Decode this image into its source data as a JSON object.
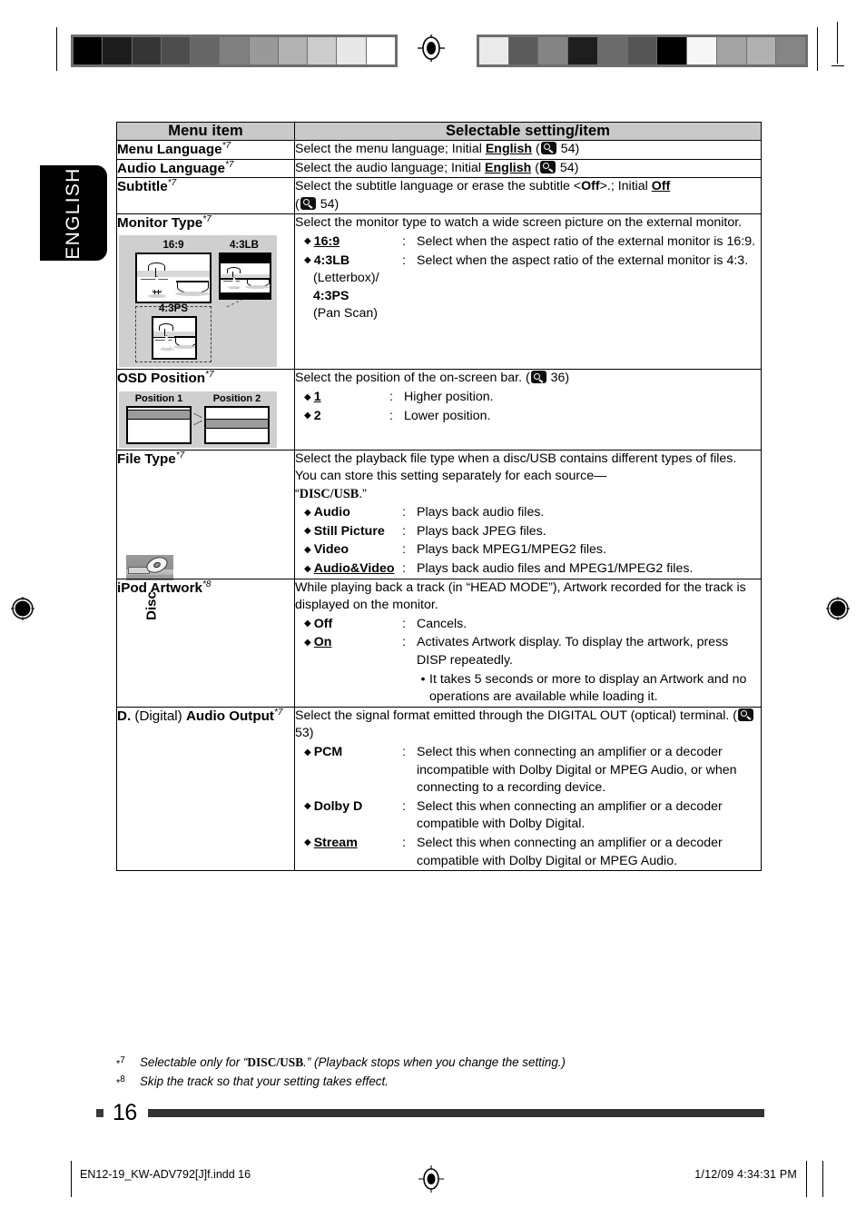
{
  "side_tab": {
    "label": "ENGLISH"
  },
  "source_marker": {
    "label": "Disc",
    "icon": "disc-icon"
  },
  "table": {
    "headers": {
      "menu_item": "Menu item",
      "selectable": "Selectable setting/item"
    },
    "rows": [
      {
        "id": "menu-language",
        "name": "Menu Language",
        "footnote": "*7",
        "description_prefix": "Select the menu language; Initial ",
        "initial_value": "English",
        "page_ref": "54"
      },
      {
        "id": "audio-language",
        "name": "Audio Language",
        "footnote": "*7",
        "description_prefix": "Select the audio language; Initial ",
        "initial_value": "English",
        "page_ref": "54"
      },
      {
        "id": "subtitle",
        "name": "Subtitle",
        "footnote": "*7",
        "description_prefix": "Select the subtitle language or erase the subtitle <",
        "inline_bold": "Off",
        "description_suffix": ">.; Initial ",
        "initial_value": "Off",
        "page_ref": "54"
      },
      {
        "id": "monitor-type",
        "name": "Monitor Type",
        "footnote": "*7",
        "description": "Select the monitor type to watch a wide screen picture on the external monitor.",
        "diagram": {
          "type": "monitor-type",
          "labels": [
            "16:9",
            "4:3LB",
            "4:3PS"
          ]
        },
        "options": [
          {
            "key": "16:9",
            "underline": true,
            "value": "Select when the aspect ratio of the external monitor is 16:9."
          },
          {
            "key": "4:3LB",
            "underline": false,
            "sub_key_lines": [
              "(Letterbox)/",
              "4:3PS",
              "(Pan Scan)"
            ],
            "value": "Select when the aspect ratio of the external monitor is 4:3."
          }
        ]
      },
      {
        "id": "osd-position",
        "name": "OSD Position",
        "footnote": "*7",
        "description_prefix": "Select the position of the on-screen bar. (",
        "page_ref": "36",
        "diagram": {
          "type": "osd-position",
          "labels": [
            "Position 1",
            "Position 2"
          ]
        },
        "options": [
          {
            "key": "1",
            "underline": true,
            "value": "Higher position."
          },
          {
            "key": "2",
            "underline": false,
            "value": "Lower position."
          }
        ]
      },
      {
        "id": "file-type",
        "name": "File Type",
        "footnote": "*7",
        "description": "Select the playback file type when a disc/USB contains different types of files. You can store this setting separately for each source—",
        "source_name": "DISC/USB",
        "options": [
          {
            "key": "Audio",
            "underline": false,
            "value": "Plays back audio files."
          },
          {
            "key": "Still Picture",
            "underline": false,
            "value": "Plays back JPEG files."
          },
          {
            "key": "Video",
            "underline": false,
            "value": "Plays back MPEG1/MPEG2 files."
          },
          {
            "key": "Audio&Video",
            "underline": true,
            "value": "Plays back audio files and MPEG1/MPEG2 files."
          }
        ]
      },
      {
        "id": "ipod-artwork",
        "name": "iPod Artwork",
        "footnote": "*8",
        "description": "While playing back a track (in “HEAD MODE”), Artwork recorded for the track is displayed on the monitor.",
        "options": [
          {
            "key": "Off",
            "underline": false,
            "value": "Cancels."
          },
          {
            "key": "On",
            "underline": true,
            "value": "Activates Artwork display. To display the artwork, press DISP repeatedly.",
            "note": "It takes 5 seconds or more to display an Artwork and no operations are available while loading it."
          }
        ]
      },
      {
        "id": "d-audio-output",
        "name_prefix": "D.",
        "name_mid": " (Digital) ",
        "name_suffix": "Audio Output",
        "footnote": "*7",
        "description_prefix": "Select the signal format emitted through the DIGITAL OUT (optical) terminal. (",
        "page_ref": "53",
        "options": [
          {
            "key": "PCM",
            "underline": false,
            "value": "Select this when connecting an amplifier or a decoder incompatible with Dolby Digital or MPEG Audio, or when connecting to a recording device."
          },
          {
            "key": "Dolby D",
            "underline": false,
            "value": "Select this when connecting an amplifier or a decoder compatible with Dolby Digital."
          },
          {
            "key": "Stream",
            "underline": true,
            "value": "Select this when connecting an amplifier or a decoder compatible with Dolby Digital or MPEG Audio."
          }
        ]
      }
    ]
  },
  "footnotes": [
    {
      "mark": "*7",
      "text_prefix": "Selectable only for “",
      "bold": "DISC/USB",
      "text_suffix": ".” (Playback stops when you change the setting.)"
    },
    {
      "mark": "*8",
      "text_prefix": "Skip the track so that your setting takes effect.",
      "bold": "",
      "text_suffix": ""
    }
  ],
  "page_number": "16",
  "imprint": {
    "file": "EN12-19_KW-ADV792[J]f.indd   16",
    "timestamp": "1/12/09   4:34:31 PM"
  },
  "colorbars": {
    "left": [
      "#000000",
      "#1c1c1c",
      "#353535",
      "#4d4d4d",
      "#666666",
      "#808080",
      "#999999",
      "#b2b2b2",
      "#cccccc",
      "#e8e8e8",
      "#ffffff"
    ],
    "right": [
      "#eaeaea",
      "#5b5b5b",
      "#848484",
      "#1e1e1e",
      "#6b6b6b",
      "#555555",
      "#000000",
      "#f6f6f6",
      "#a3a3a3",
      "#b0b0b0",
      "#858585"
    ]
  }
}
